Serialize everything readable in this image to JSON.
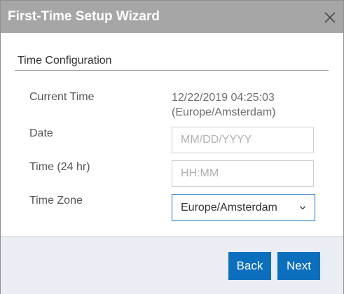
{
  "dialog": {
    "title": "First-Time Setup Wizard",
    "close_icon": "close-icon"
  },
  "section": {
    "title": "Time Configuration"
  },
  "current_time": {
    "label": "Current Time",
    "value": "12/22/2019 04:25:03",
    "zone": "(Europe/Amsterdam)"
  },
  "date": {
    "label": "Date",
    "value": "",
    "placeholder": "MM/DD/YYYY"
  },
  "time": {
    "label": "Time (24 hr)",
    "value": "",
    "placeholder": "HH:MM"
  },
  "timezone": {
    "label": "Time Zone",
    "selected": "Europe/Amsterdam",
    "chevron_icon": "chevron-down-icon"
  },
  "footer": {
    "back_label": "Back",
    "next_label": "Next"
  },
  "colors": {
    "titlebar": "#a6a6a6",
    "primary_button": "#0b6fbd",
    "select_border": "#1f72c4",
    "footer_bg": "#eaeef4"
  }
}
